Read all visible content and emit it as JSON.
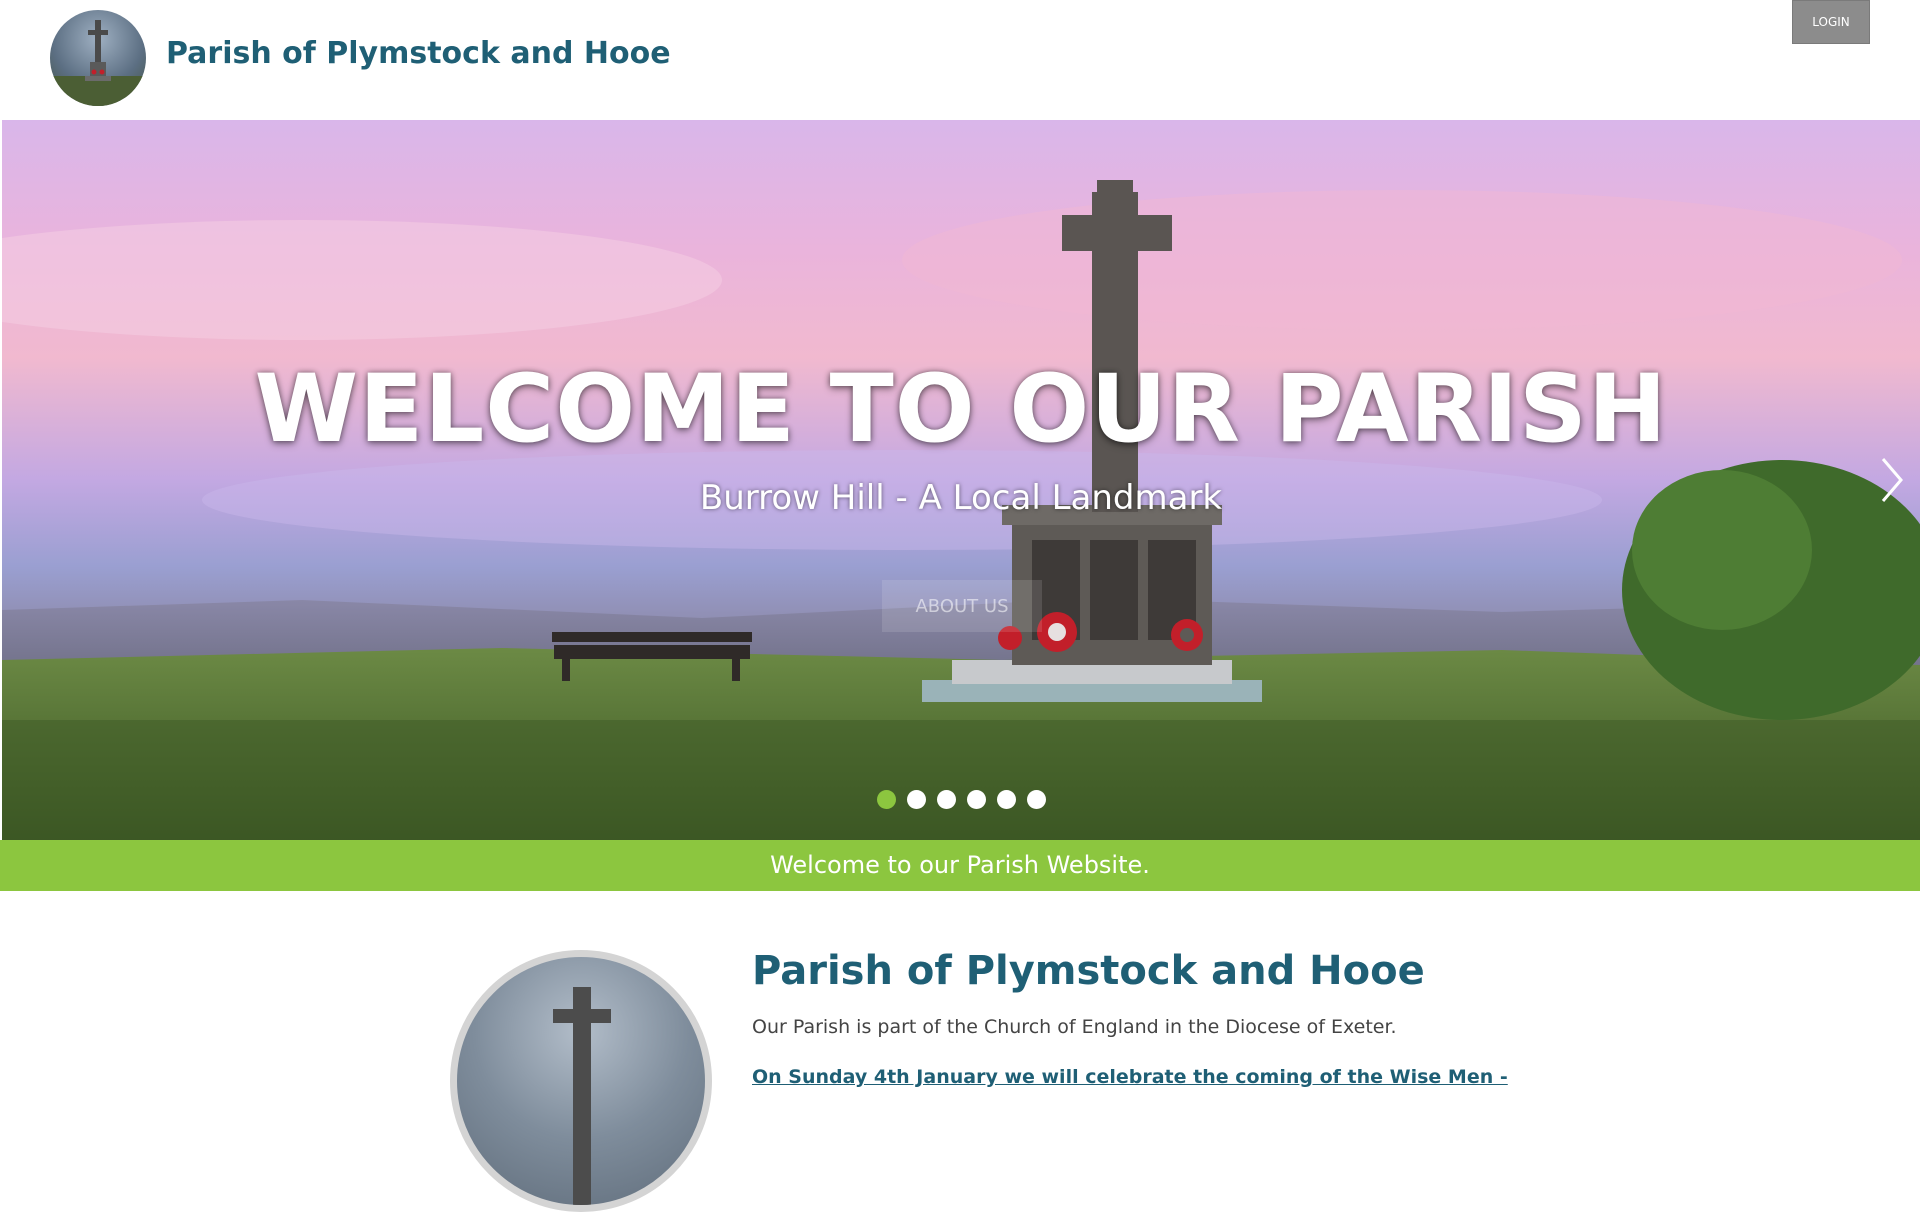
{
  "header": {
    "site_title": "Parish of Plymstock and Hooe",
    "login_label": "LOGIN"
  },
  "hero": {
    "title": "WELCOME TO OUR PARISH",
    "subtitle": "Burrow Hill - A Local Landmark",
    "cta_label": "ABOUT US",
    "slide_count": 6,
    "active_slide": 1
  },
  "banner": {
    "text": "Welcome to our Parish Website."
  },
  "content": {
    "heading": "Parish of Plymstock and Hooe",
    "intro": "Our Parish is part of the Church of England in the Diocese of Exeter.",
    "notice": "On Sunday 4th January we will celebrate the coming of the Wise Men -"
  },
  "colors": {
    "brand_teal": "#1f5f75",
    "accent_green": "#8cc63f",
    "login_gray": "#8c8c8c"
  },
  "icons": {
    "next": "chevron-right-icon",
    "prev": "chevron-left-icon"
  }
}
